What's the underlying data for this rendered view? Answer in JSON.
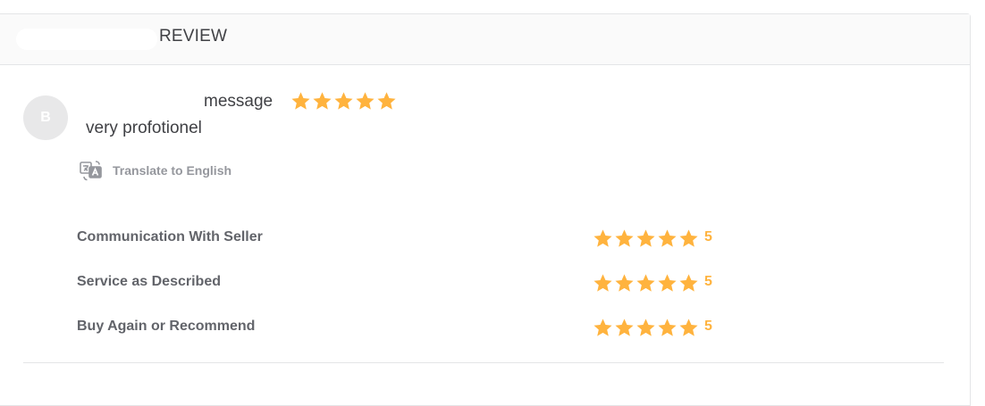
{
  "header": {
    "title": "REVIEW"
  },
  "review": {
    "avatar_initial": "B",
    "message_label": "message",
    "overall_rating": 5,
    "text": "very profotionel",
    "translate_label": "Translate to English"
  },
  "ratings": [
    {
      "label": "Communication With Seller",
      "value": "5"
    },
    {
      "label": "Service as Described",
      "value": "5"
    },
    {
      "label": "Buy Again or Recommend",
      "value": "5"
    }
  ],
  "colors": {
    "star": "#ffb33e",
    "text": "#404145",
    "muted": "#95979d"
  },
  "icons": {
    "star": "star-icon",
    "translate": "translate-icon"
  }
}
